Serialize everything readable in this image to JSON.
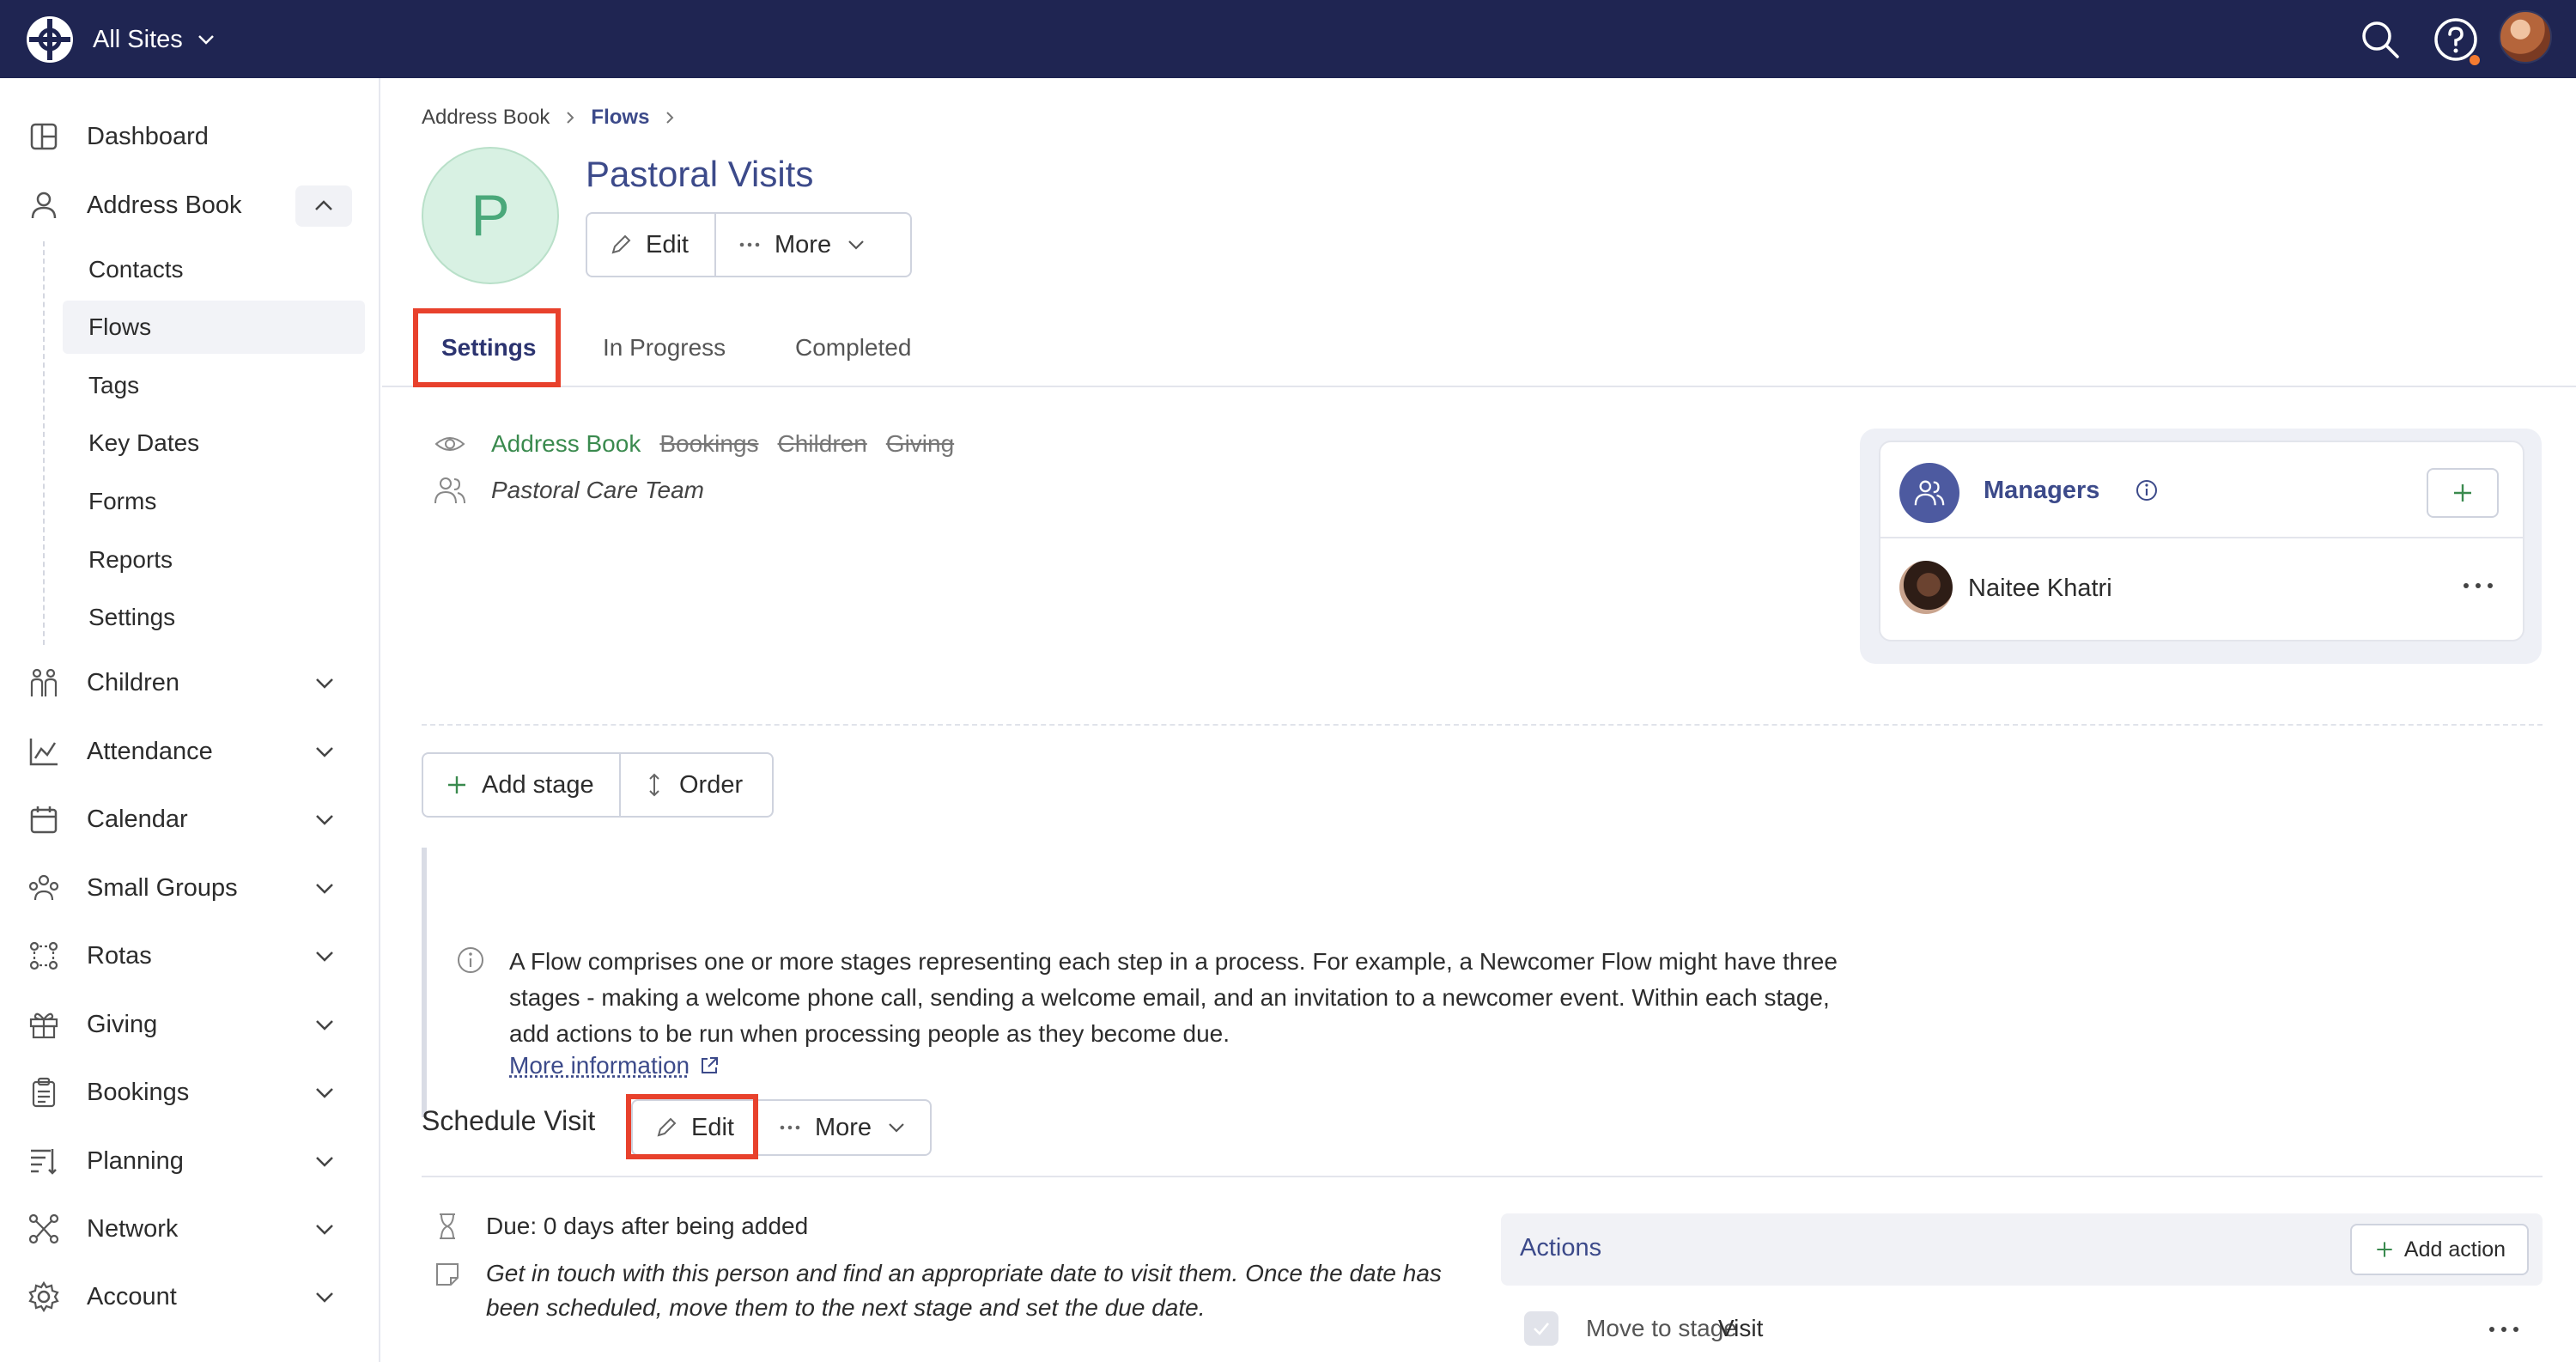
{
  "topbar": {
    "site_label": "All Sites",
    "icons": [
      "globe-logo-icon",
      "search-icon",
      "help-icon",
      "user-avatar"
    ]
  },
  "sidebar": {
    "items": [
      {
        "label": "Dashboard",
        "icon": "dashboard-icon"
      },
      {
        "label": "Address Book",
        "icon": "person-icon",
        "expanded": true
      },
      {
        "label": "Children",
        "icon": "children-icon"
      },
      {
        "label": "Attendance",
        "icon": "chart-icon"
      },
      {
        "label": "Calendar",
        "icon": "calendar-icon"
      },
      {
        "label": "Small Groups",
        "icon": "group-icon"
      },
      {
        "label": "Rotas",
        "icon": "rotas-icon"
      },
      {
        "label": "Giving",
        "icon": "gift-icon"
      },
      {
        "label": "Bookings",
        "icon": "clipboard-icon"
      },
      {
        "label": "Planning",
        "icon": "planning-icon"
      },
      {
        "label": "Network",
        "icon": "network-icon"
      },
      {
        "label": "Account",
        "icon": "gear-icon"
      }
    ],
    "sub_items": [
      "Contacts",
      "Flows",
      "Tags",
      "Key Dates",
      "Forms",
      "Reports",
      "Settings"
    ],
    "active_sub_item": "Flows"
  },
  "breadcrumb": {
    "root": "Address Book",
    "current": "Flows"
  },
  "flow": {
    "avatar_letter": "P",
    "title": "Pastoral Visits",
    "edit_label": "Edit",
    "more_label": "More"
  },
  "tabs": {
    "settings": "Settings",
    "in_progress": "In Progress",
    "completed": "Completed",
    "active": "Settings"
  },
  "scope": {
    "active": "Address Book",
    "inactive": [
      "Bookings",
      "Children",
      "Giving"
    ],
    "team": "Pastoral Care Team"
  },
  "managers": {
    "title": "Managers",
    "people": [
      {
        "name": "Naitee Khatri"
      }
    ]
  },
  "stage_toolbar": {
    "add_stage": "Add stage",
    "order": "Order"
  },
  "info": {
    "text": "A Flow comprises one or more stages representing each step in a process. For example, a Newcomer Flow might have three stages - making a welcome phone call, sending a welcome email, and an invitation to a newcomer event. Within each stage, add actions to be run when processing people as they become due.",
    "link": "More information"
  },
  "stage": {
    "title": "Schedule Visit",
    "edit_label": "Edit",
    "more_label": "More",
    "due": "Due: 0 days after being added",
    "description": "Get in touch with this person and find an appropriate date to visit them. Once the date has been scheduled, move them to the next stage and set the due date.",
    "actions_title": "Actions",
    "add_action": "Add action",
    "actions": [
      {
        "label": "Move to stage",
        "value": "Visit"
      }
    ]
  },
  "colors": {
    "topbar": "#1f2552",
    "accent": "#3c4a8a",
    "highlight": "#e8412c",
    "green": "#3a8a4e"
  }
}
